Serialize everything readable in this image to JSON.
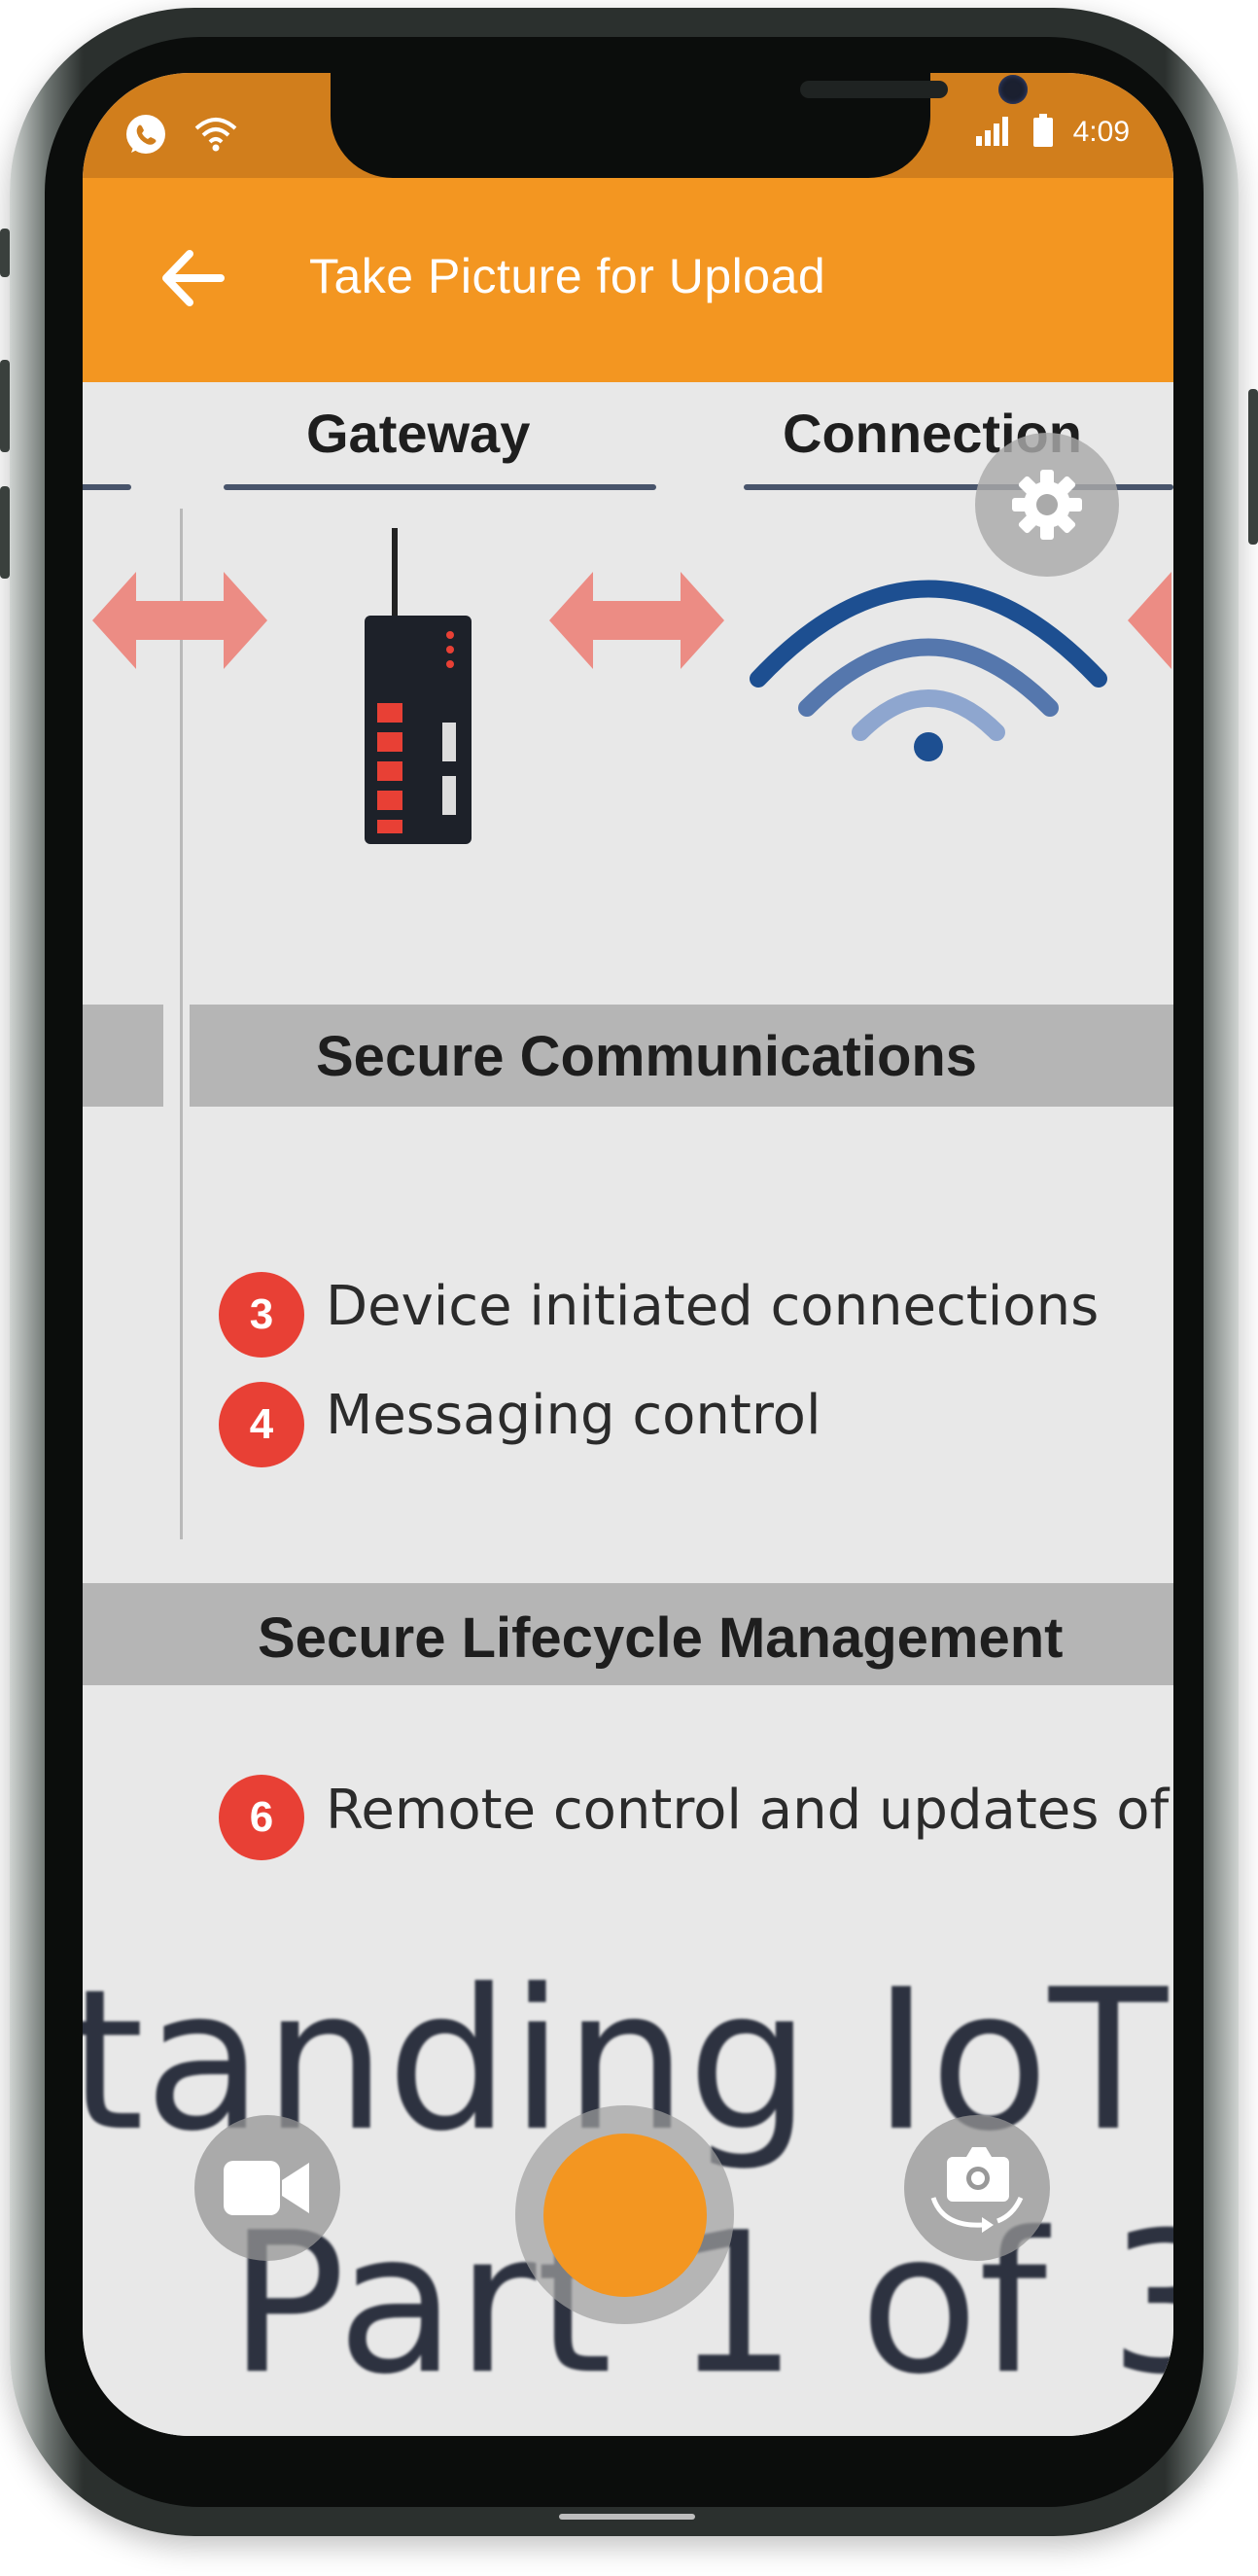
{
  "status_bar": {
    "time": "4:09",
    "icons": [
      "whatsapp-icon",
      "wifi-icon",
      "signal-icon",
      "battery-icon"
    ]
  },
  "app_bar": {
    "title": "Take Picture for Upload",
    "back_icon": "arrow-left-icon",
    "background_color": "#f39621"
  },
  "viewfinder": {
    "headers": [
      "Gateway",
      "Connection"
    ],
    "section_secure_comms": "Secure Communications",
    "bullets_comms": [
      {
        "num": "3",
        "text": "Device initiated connections"
      },
      {
        "num": "4",
        "text": "Messaging control"
      }
    ],
    "section_lifecycle": "Secure Lifecycle Management",
    "bullets_lifecycle": [
      {
        "num": "6",
        "text": "Remote control and updates of"
      }
    ],
    "big_line_1": "tanding IoT S",
    "big_line_2": "Part 1 of 3"
  },
  "controls": {
    "settings_icon": "gear-icon",
    "video_icon": "video-camera-icon",
    "shutter_color": "#f39621",
    "switch_camera_icon": "switch-camera-icon"
  }
}
